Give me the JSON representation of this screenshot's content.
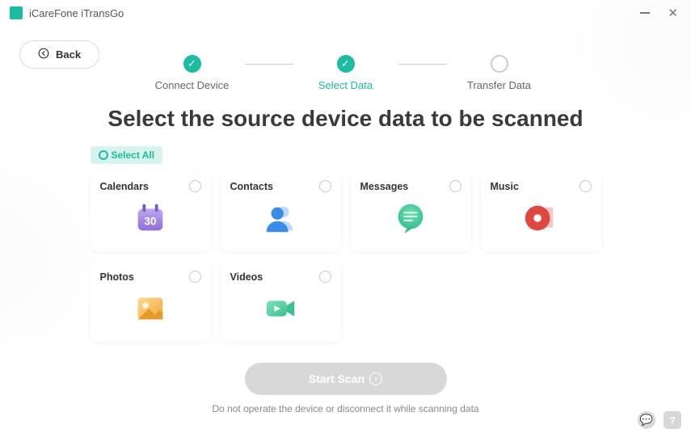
{
  "app": {
    "title": "iCareFone iTransGo"
  },
  "back": {
    "label": "Back"
  },
  "stepper": {
    "steps": [
      {
        "label": "Connect Device",
        "state": "done"
      },
      {
        "label": "Select Data",
        "state": "active"
      },
      {
        "label": "Transfer Data",
        "state": "pending"
      }
    ]
  },
  "heading": "Select the source device data to be scanned",
  "select_all": {
    "label": "Select All"
  },
  "cards": [
    {
      "title": "Calendars",
      "icon": "calendar-icon"
    },
    {
      "title": "Contacts",
      "icon": "contacts-icon"
    },
    {
      "title": "Messages",
      "icon": "messages-icon"
    },
    {
      "title": "Music",
      "icon": "music-icon"
    },
    {
      "title": "Photos",
      "icon": "photos-icon"
    },
    {
      "title": "Videos",
      "icon": "videos-icon"
    }
  ],
  "scan": {
    "label": "Start Scan"
  },
  "note": "Do not operate the device or disconnect it while scanning data"
}
